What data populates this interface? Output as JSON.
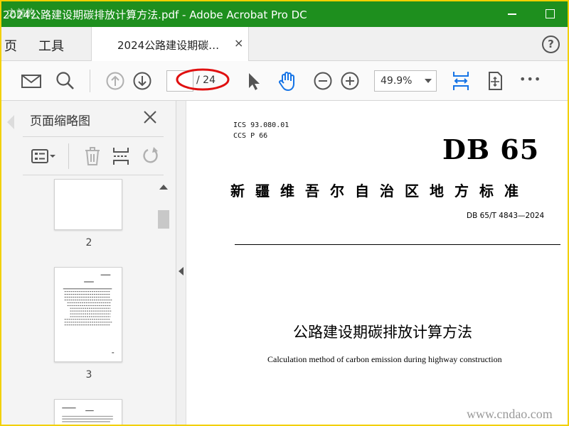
{
  "window": {
    "title": "2024公路建设期碳排放计算方法.pdf - Adobe Acrobat Pro DC",
    "watermark_logo": "之前的"
  },
  "tabbar": {
    "home_label": "页",
    "tools_label": "工具",
    "document_tab_label": "2024公路建设期碳…",
    "close_glyph": "×",
    "help_glyph": "?"
  },
  "toolbar": {
    "page_current": "",
    "page_total": "/ 24",
    "zoom_value": "49.9%",
    "more_glyph": "•••"
  },
  "panel": {
    "title": "页面缩略图",
    "thumbnails": [
      {
        "label": "2"
      },
      {
        "label": "3"
      }
    ]
  },
  "document": {
    "ics_line": "ICS  93.080.01",
    "ccs_line": "CCS  P 66",
    "logo": "DB 65",
    "standard_title": "新疆维吾尔自治区地方标准",
    "standard_number": "DB 65/T 4843—2024",
    "title_cn": "公路建设期碳排放计算方法",
    "title_en": "Calculation method of carbon emission during highway construction",
    "site_watermark": "www.cndao.com"
  },
  "colors": {
    "titlebar": "#1e8f1e",
    "frame": "#f2d000",
    "annotation": "#e01010",
    "icon_blue": "#1473e6"
  }
}
